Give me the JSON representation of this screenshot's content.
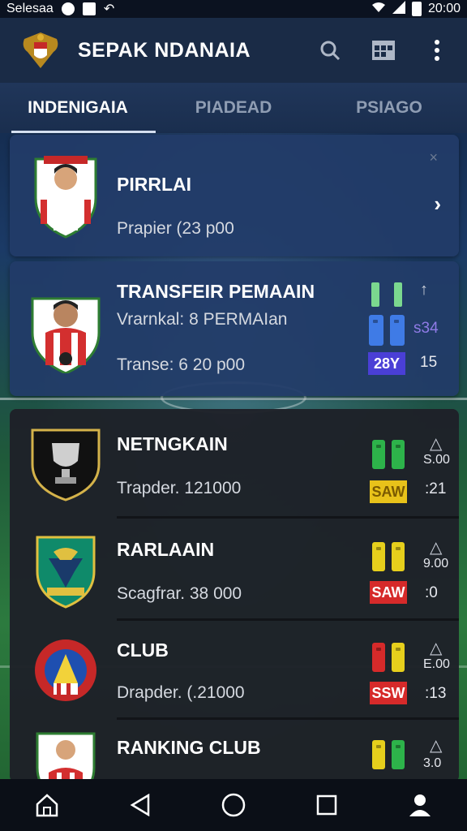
{
  "status_bar": {
    "left_text": "Selesaa",
    "time": "20:00"
  },
  "app_bar": {
    "title": "SEPAK NDANAIA"
  },
  "tabs": [
    {
      "label": "INDENIGAIA",
      "active": true
    },
    {
      "label": "PIADEAD",
      "active": false
    },
    {
      "label": "PSIAGO",
      "active": false
    }
  ],
  "featured": {
    "name": "PIRRLAI",
    "detail": "Prapier (23 p00"
  },
  "transfer": {
    "title": "TRANSFEIR PEMAAIN",
    "subtitle": "Vrarnkal: 8 PERMAIan",
    "detail": "Transe: 6 20 p00",
    "stat_badge": "28Y",
    "stat_value": "15",
    "side_text": "s34"
  },
  "clubs": [
    {
      "name": "NETNGKAIN",
      "detail": "Trapder. 121000",
      "badge": "SAW",
      "value": ":21",
      "side": "S.00",
      "pill_colors": [
        "#2db34a",
        "#2db34a"
      ],
      "badge_color": "#e8c21a",
      "badge_text_color": "#7a5a00"
    },
    {
      "name": "RARLAAIN",
      "detail": "Scagfrar. 38 000",
      "badge": "SAW",
      "value": ":0",
      "side": "9.00",
      "pill_colors": [
        "#e6cf1c",
        "#e6cf1c"
      ],
      "badge_color": "#d62a2a",
      "badge_text_color": "#ffffff"
    },
    {
      "name": "CLUB",
      "detail": "Drapder. (.21000",
      "badge": "SSW",
      "value": ":13",
      "side": "E.00",
      "pill_colors": [
        "#d62a2a",
        "#e6cf1c"
      ],
      "badge_color": "#d62a2a",
      "badge_text_color": "#ffffff"
    },
    {
      "name": "RANKING CLUB",
      "detail": "",
      "badge": "",
      "value": "",
      "side": "3.0",
      "pill_colors": [
        "#e6cf1c",
        "#2db34a"
      ],
      "badge_color": "#d62a2a",
      "badge_text_color": "#ffffff"
    }
  ],
  "icons": {
    "search": "search-icon",
    "calendar": "calendar-icon",
    "more": "more-vert-icon",
    "home": "home-icon",
    "back": "back-icon",
    "circle": "home-circle-icon",
    "recent": "recent-apps-icon",
    "profile": "profile-icon"
  },
  "colors": {
    "accent": "#d6e1f2",
    "card_blue": "#223c68",
    "card_dark": "#1e2128"
  }
}
